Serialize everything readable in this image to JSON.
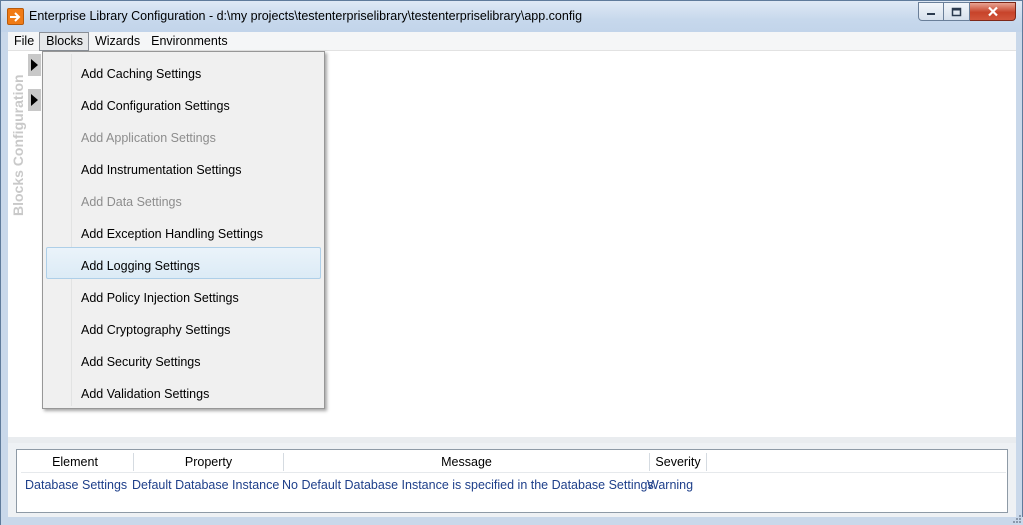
{
  "window": {
    "title": "Enterprise Library Configuration - d:\\my projects\\testenterpriselibrary\\testenterpriselibrary\\app.config",
    "app_icon": "enterprise-library-icon"
  },
  "menubar": {
    "items": [
      {
        "label": "File",
        "active": false
      },
      {
        "label": "Blocks",
        "active": true
      },
      {
        "label": "Wizards",
        "active": false
      },
      {
        "label": "Environments",
        "active": false
      }
    ]
  },
  "sidebar": {
    "label": "Blocks Configuration",
    "arrow_icon": "expand-arrow-icon"
  },
  "blocks_menu": {
    "items": [
      {
        "label": "Add Caching Settings",
        "enabled": true,
        "highlighted": false
      },
      {
        "label": "Add Configuration Settings",
        "enabled": true,
        "highlighted": false
      },
      {
        "label": "Add Application Settings",
        "enabled": false,
        "highlighted": false
      },
      {
        "label": "Add Instrumentation Settings",
        "enabled": true,
        "highlighted": false
      },
      {
        "label": "Add Data Settings",
        "enabled": false,
        "highlighted": false
      },
      {
        "label": "Add Exception Handling Settings",
        "enabled": true,
        "highlighted": false
      },
      {
        "label": "Add Logging Settings",
        "enabled": true,
        "highlighted": true
      },
      {
        "label": "Add Policy Injection Settings",
        "enabled": true,
        "highlighted": false
      },
      {
        "label": "Add Cryptography Settings",
        "enabled": true,
        "highlighted": false
      },
      {
        "label": "Add Security Settings",
        "enabled": true,
        "highlighted": false
      },
      {
        "label": "Add Validation Settings",
        "enabled": true,
        "highlighted": false
      }
    ]
  },
  "errors_grid": {
    "columns": [
      "Element",
      "Property",
      "Message",
      "Severity"
    ],
    "rows": [
      {
        "element": "Database Settings",
        "property": "Default Database Instance",
        "message": "No Default Database Instance is specified in the Database Settings.",
        "severity": "Warning"
      }
    ]
  },
  "colors": {
    "title_gradient": "#c7d8ec",
    "close_button": "#c7432a",
    "menu_hover": "#dcebf6",
    "disabled_text": "#8d8d8d",
    "grid_text": "#1e3f8a"
  }
}
